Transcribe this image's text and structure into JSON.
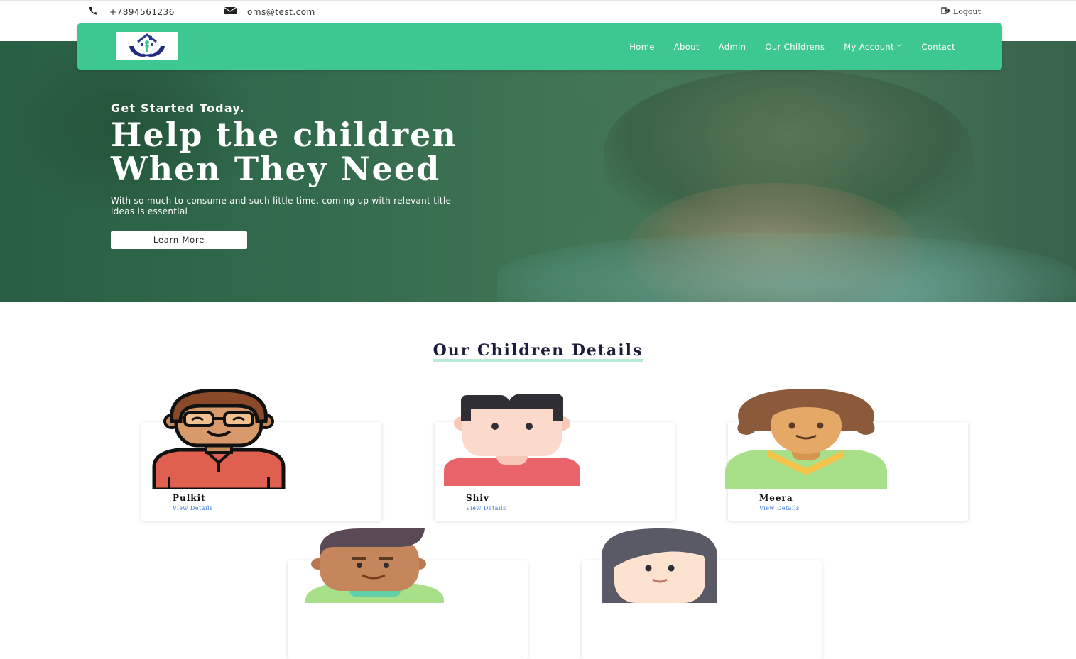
{
  "topbar": {
    "phone": "+7894561236",
    "email": "oms@test.com",
    "logout": "Logout"
  },
  "nav": {
    "logo_icon": "orphanage-home-logo",
    "items": [
      {
        "label": "Home"
      },
      {
        "label": "About"
      },
      {
        "label": "Admin"
      },
      {
        "label": "Our Childrens"
      },
      {
        "label": "My Account",
        "dropdown": true
      },
      {
        "label": "Contact"
      }
    ],
    "background": "#3cc890"
  },
  "hero": {
    "subtitle": "Get Started Today.",
    "title_line1": "Help the children",
    "title_line2": "When They Need",
    "description": "With so much to consume and such little time, coming up with relevant title ideas is essential",
    "button": "Learn More"
  },
  "section": {
    "title": "Our Children Details"
  },
  "children": [
    {
      "name": "Pulkit",
      "link": "View Details"
    },
    {
      "name": "Shiv",
      "link": "View Details"
    },
    {
      "name": "Meera",
      "link": "View Details"
    },
    {
      "name": "",
      "link": ""
    },
    {
      "name": "",
      "link": ""
    }
  ]
}
